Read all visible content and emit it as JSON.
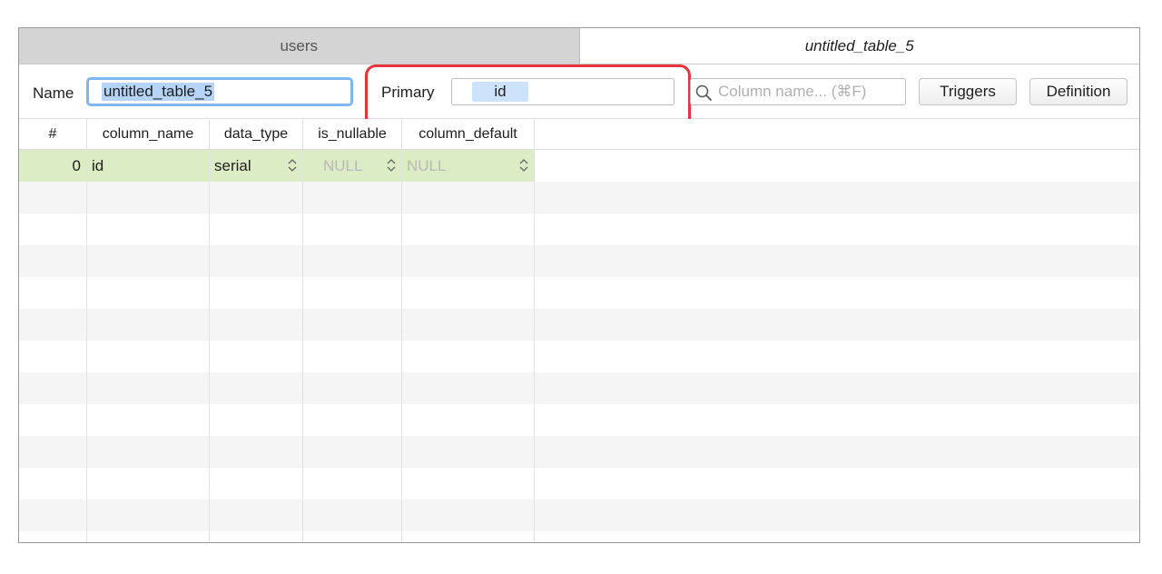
{
  "tabs": [
    {
      "label": "users",
      "active": false
    },
    {
      "label": "untitled_table_5",
      "active": true
    }
  ],
  "toolbar": {
    "name_label": "Name",
    "name_value": "untitled_table_5",
    "primary_label": "Primary",
    "primary_value": "id",
    "search_placeholder": "Column name... (⌘F)",
    "triggers_label": "Triggers",
    "definition_label": "Definition"
  },
  "grid": {
    "columns": [
      "#",
      "column_name",
      "data_type",
      "is_nullable",
      "column_default"
    ],
    "rows": [
      {
        "index": "0",
        "column_name": "id",
        "data_type": "serial",
        "is_nullable": "NULL",
        "column_default": "NULL"
      }
    ]
  },
  "colors": {
    "highlight": "#e8333c",
    "selected_row": "#dcecc4",
    "focus_ring": "#7eb6ef"
  }
}
